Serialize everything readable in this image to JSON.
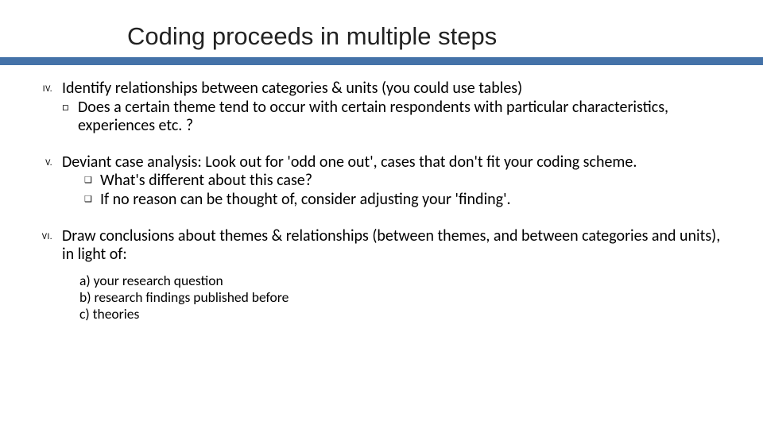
{
  "title": "Coding proceeds in multiple steps",
  "items": [
    {
      "marker": "IV.",
      "text": "Identify relationships between categories & units  (you could use tables)",
      "subs": [
        {
          "bullet": "□",
          "style": "box",
          "text": "Does a certain theme tend to occur with certain respondents with particular characteristics, experiences etc. ?"
        }
      ]
    },
    {
      "marker": "V.",
      "text": "Deviant case analysis: Look out for 'odd one out', cases that don't fit your coding scheme.",
      "subs": [
        {
          "bullet": "❑",
          "style": "q",
          "text": "What's different about this case?"
        },
        {
          "bullet": "❑",
          "style": "q",
          "text": "If no reason can be thought of, consider adjusting your 'finding'."
        }
      ]
    },
    {
      "marker": "VI.",
      "text": "Draw conclusions about themes & relationships (between themes, and between categories and units), in light of:",
      "subs": []
    }
  ],
  "letters": [
    "a) your research question",
    "b) research findings published before",
    "c) theories"
  ]
}
